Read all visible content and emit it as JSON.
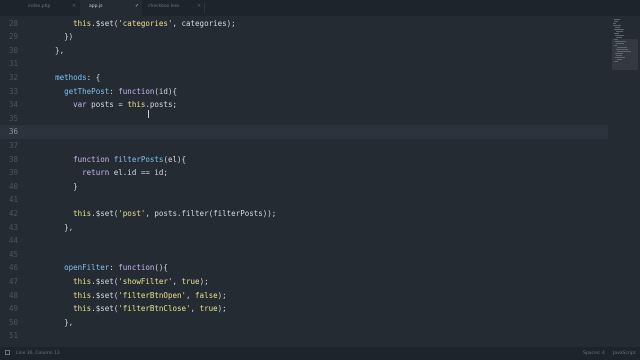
{
  "tabs": [
    {
      "name": "index.php",
      "close": "×",
      "active": false
    },
    {
      "name": "app.js",
      "close": "✓",
      "active": true
    },
    {
      "name": "checkbox.less",
      "close": "×",
      "active": false
    }
  ],
  "editor": {
    "lines": [
      {
        "num": "28",
        "tokens": [
          {
            "t": "        "
          },
          {
            "t": "this",
            "c": "this"
          },
          {
            "t": ".$set("
          },
          {
            "t": "'categories'",
            "c": "str"
          },
          {
            "t": ", categories);"
          }
        ]
      },
      {
        "num": "29",
        "tokens": [
          {
            "t": "      })"
          }
        ]
      },
      {
        "num": "30",
        "tokens": [
          {
            "t": "    },"
          }
        ]
      },
      {
        "num": "31",
        "tokens": []
      },
      {
        "num": "32",
        "tokens": [
          {
            "t": "    "
          },
          {
            "t": "methods",
            "c": "fn"
          },
          {
            "t": ": {"
          }
        ]
      },
      {
        "num": "33",
        "tokens": [
          {
            "t": "      "
          },
          {
            "t": "getThePost",
            "c": "fn"
          },
          {
            "t": ": "
          },
          {
            "t": "function",
            "c": "kw"
          },
          {
            "t": "(id){"
          }
        ]
      },
      {
        "num": "34",
        "tokens": [
          {
            "t": "        "
          },
          {
            "t": "var",
            "c": "kw"
          },
          {
            "t": " posts = "
          },
          {
            "t": "this",
            "c": "this"
          },
          {
            "t": ".posts;"
          }
        ]
      },
      {
        "num": "35",
        "tokens": []
      },
      {
        "num": "36",
        "tokens": [],
        "current": true
      },
      {
        "num": "37",
        "tokens": []
      },
      {
        "num": "38",
        "tokens": [
          {
            "t": "        "
          },
          {
            "t": "function",
            "c": "kw"
          },
          {
            "t": " "
          },
          {
            "t": "filterPosts",
            "c": "fn"
          },
          {
            "t": "(el){"
          }
        ]
      },
      {
        "num": "39",
        "tokens": [
          {
            "t": "          "
          },
          {
            "t": "return",
            "c": "kw"
          },
          {
            "t": " el.id == id;"
          }
        ]
      },
      {
        "num": "40",
        "tokens": [
          {
            "t": "        }"
          }
        ]
      },
      {
        "num": "41",
        "tokens": []
      },
      {
        "num": "42",
        "tokens": [
          {
            "t": "        "
          },
          {
            "t": "this",
            "c": "this"
          },
          {
            "t": ".$set("
          },
          {
            "t": "'post'",
            "c": "str"
          },
          {
            "t": ", posts.filter(filterPosts));"
          }
        ]
      },
      {
        "num": "43",
        "tokens": [
          {
            "t": "      },"
          }
        ]
      },
      {
        "num": "44",
        "tokens": []
      },
      {
        "num": "45",
        "tokens": []
      },
      {
        "num": "46",
        "tokens": [
          {
            "t": "      "
          },
          {
            "t": "openFilter",
            "c": "fn"
          },
          {
            "t": ": "
          },
          {
            "t": "function",
            "c": "kw"
          },
          {
            "t": "(){"
          }
        ]
      },
      {
        "num": "47",
        "tokens": [
          {
            "t": "        "
          },
          {
            "t": "this",
            "c": "this"
          },
          {
            "t": ".$set("
          },
          {
            "t": "'showFilter'",
            "c": "str"
          },
          {
            "t": ", "
          },
          {
            "t": "true",
            "c": "num"
          },
          {
            "t": ");"
          }
        ]
      },
      {
        "num": "48",
        "tokens": [
          {
            "t": "        "
          },
          {
            "t": "this",
            "c": "this"
          },
          {
            "t": ".$set("
          },
          {
            "t": "'filterBtnOpen'",
            "c": "str"
          },
          {
            "t": ", "
          },
          {
            "t": "false",
            "c": "num"
          },
          {
            "t": ");"
          }
        ]
      },
      {
        "num": "49",
        "tokens": [
          {
            "t": "        "
          },
          {
            "t": "this",
            "c": "this"
          },
          {
            "t": ".$set("
          },
          {
            "t": "'filterBtnClose'",
            "c": "str"
          },
          {
            "t": ", "
          },
          {
            "t": "true",
            "c": "num"
          },
          {
            "t": ");"
          }
        ]
      },
      {
        "num": "50",
        "tokens": [
          {
            "t": "      },"
          }
        ]
      },
      {
        "num": "51",
        "tokens": []
      }
    ]
  },
  "statusbar": {
    "position": "Line 36, Column 13",
    "spaces": "Spaces: 4",
    "syntax": "JavaScript"
  },
  "colors": {
    "background": "#252b33",
    "tabbar": "#1e242b",
    "keyword": "#c8b4ee",
    "string": "#e6e08a",
    "function": "#7ec2f0"
  }
}
